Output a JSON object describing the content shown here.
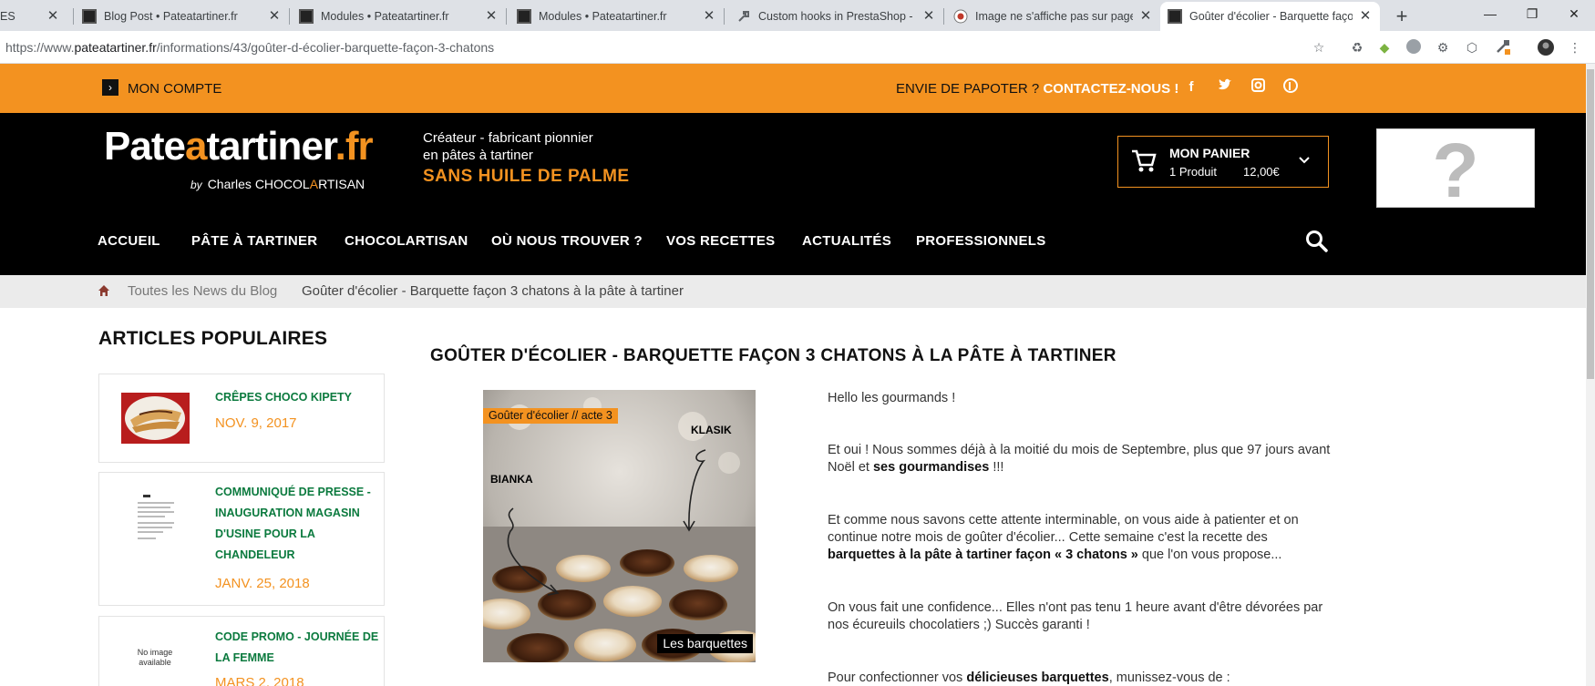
{
  "browser": {
    "tabs": [
      {
        "title": "ES",
        "icon": "page-icon"
      },
      {
        "title": "Blog Post • Pateatartiner.fr",
        "icon": "site-icon"
      },
      {
        "title": "Modules • Pateatartiner.fr",
        "icon": "site-icon"
      },
      {
        "title": "Modules • Pateatartiner.fr",
        "icon": "site-icon"
      },
      {
        "title": "Custom hooks in PrestaShop - ht",
        "icon": "tools-icon"
      },
      {
        "title": "Image ne s'affiche pas sur page C",
        "icon": "forum-icon"
      },
      {
        "title": "Goûter d'écolier - Barquette faço",
        "icon": "site-icon"
      }
    ],
    "new_tab": "+",
    "url_prefix": "https://www.",
    "url_host": "pateatartiner.fr",
    "url_path": "/informations/43/goûter-d-écolier-barquette-façon-3-chatons",
    "minimize": "—",
    "restore": "❐",
    "close": "✕"
  },
  "topbar": {
    "account_label": "MON COMPTE",
    "chat_text": "ENVIE DE PAPOTER ?",
    "contact_text": "CONTACTEZ-NOUS !"
  },
  "header": {
    "logo_part1": "Pate",
    "logo_part2": "a",
    "logo_part3": "tartiner",
    "logo_part4": ".fr",
    "byline_by": "by",
    "byline_name1": "Charles CHOCOL",
    "byline_name2": "A",
    "byline_name3": "RTISAN",
    "tagline_line1": "Créateur - fabricant pionnier",
    "tagline_line2": "en pâtes à tartiner",
    "tagline_highlight": "SANS HUILE DE PALME",
    "cart_title": "MON PANIER",
    "cart_count": "1 Produit",
    "cart_price": "12,00€",
    "placeholder": "?"
  },
  "nav": {
    "items": [
      "ACCUEIL",
      "PÂTE À TARTINER",
      "CHOCOLARTISAN",
      "OÙ NOUS TROUVER ?",
      "VOS RECETTES",
      "ACTUALITÉS",
      "PROFESSIONNELS"
    ]
  },
  "breadcrumb": {
    "blog": "Toutes les News du Blog",
    "current": "Goûter d'écolier - Barquette façon 3 chatons à la pâte à tartiner"
  },
  "sidebar": {
    "title": "ARTICLES POPULAIRES",
    "posts": [
      {
        "title": "Crêpes Choco Kipety",
        "date": "NOV. 9, 2017"
      },
      {
        "title": "Communiqué de presse - Inauguration magasin d'usine pour la Chandeleur",
        "date": "JANV. 25, 2018"
      },
      {
        "title": "Code promo - Journée de la femme",
        "date": "MARS 2, 2018",
        "noimage": "No image available"
      }
    ]
  },
  "article": {
    "title": "GOÛTER D'ÉCOLIER - BARQUETTE FAÇON 3 CHATONS À LA PÂTE À TARTINER",
    "image": {
      "badge": "Goûter d'écolier // acte 3",
      "label_left": "BIANKA",
      "label_right": "KLASIK",
      "caption": "Les barquettes"
    },
    "p1": "Hello les gourmands !",
    "p2a": "Et oui ! Nous sommes déjà à la moitié du mois de Septembre, plus que 97 jours avant Noël et ",
    "p2b": "ses gourmandises",
    "p2c": " !!!",
    "p3a": "Et comme nous savons cette attente interminable, on vous aide à patienter et on continue notre mois de goûter d'écolier... Cette semaine c'est la recette des ",
    "p3b": "barquettes à la pâte à tartiner façon « 3 chatons »",
    "p3c": " que l'on vous propose...",
    "p4": "On vous fait une confidence... Elles n'ont pas tenu 1 heure avant d'être dévorées par nos écureuils chocolatiers ;) Succès garanti !",
    "p5a": "Pour confectionner vos ",
    "p5b": "délicieuses barquettes",
    "p5c": ", munissez-vous de :"
  }
}
